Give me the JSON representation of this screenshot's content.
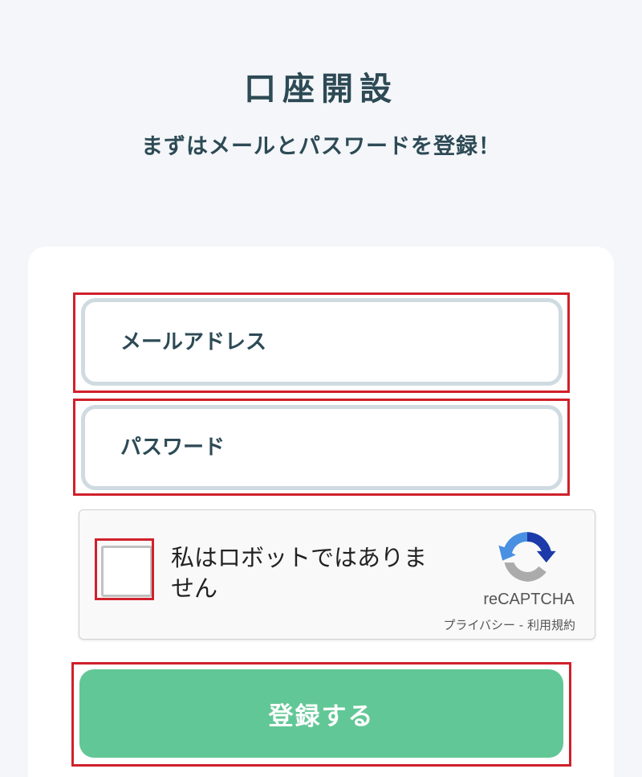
{
  "header": {
    "title": "口座開設",
    "subtitle": "まずはメールとパスワードを登録！"
  },
  "form": {
    "email": {
      "value": "",
      "placeholder": "メールアドレス"
    },
    "password": {
      "value": "",
      "placeholder": "パスワード"
    },
    "submit_label": "登録する"
  },
  "recaptcha": {
    "label": "私はロボットではありません",
    "brand": "reCAPTCHA",
    "privacy_link": "プライバシー",
    "separator": " - ",
    "terms_link": "利用規約",
    "icon": "recaptcha-logo-icon",
    "checked": false
  },
  "colors": {
    "accent": "#62c796",
    "highlight": "#d0212b",
    "text": "#2d4a55",
    "field_border": "#cfdbe0"
  }
}
